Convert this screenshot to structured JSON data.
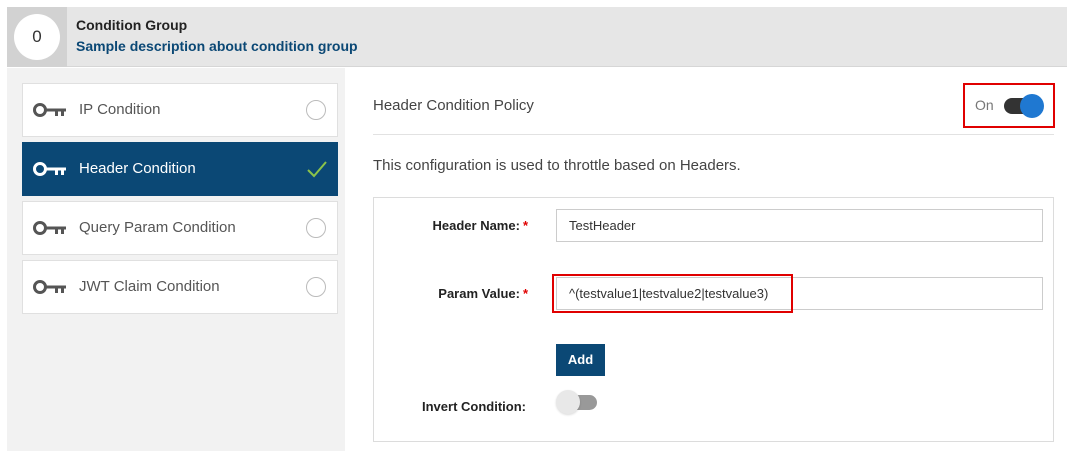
{
  "group": {
    "number": "0",
    "title": "Condition Group",
    "description": "Sample description about condition group"
  },
  "conditions": [
    {
      "label": "IP Condition",
      "icon": "key-icon",
      "selected": false
    },
    {
      "label": "Header Condition",
      "icon": "key-icon",
      "selected": true
    },
    {
      "label": "Query Param Condition",
      "icon": "key-icon",
      "selected": false
    },
    {
      "label": "JWT Claim Condition",
      "icon": "key-icon",
      "selected": false
    }
  ],
  "policy": {
    "title": "Header Condition Policy",
    "toggle_label": "On",
    "enabled": true,
    "description": "This configuration is used to throttle based on Headers."
  },
  "form": {
    "header_name_label": "Header Name:",
    "header_name_value": "TestHeader",
    "param_value_label": "Param Value:",
    "param_value_value": "^(testvalue1|testvalue2|testvalue3)",
    "required_marker": "*",
    "add_label": "Add",
    "invert_label": "Invert Condition:",
    "invert_enabled": false
  },
  "colors": {
    "primary": "#0b4875",
    "toggle_on": "#1f78d1",
    "highlight": "#e00000",
    "check": "#8bc34a"
  }
}
